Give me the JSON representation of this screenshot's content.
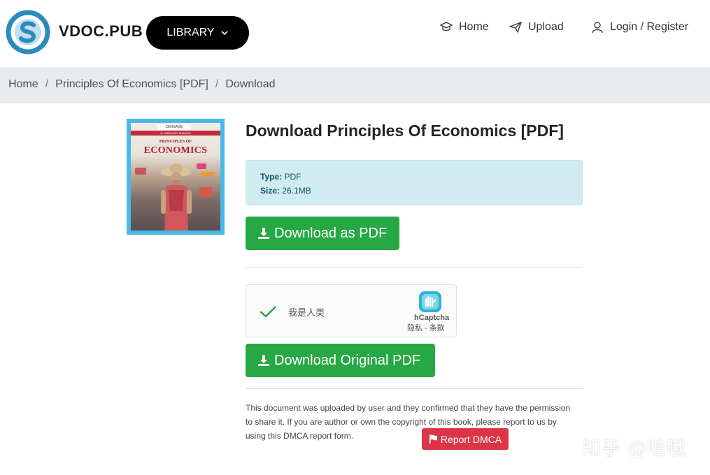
{
  "header": {
    "brand": "VDOC.PUB",
    "library_label": "LIBRARY",
    "nav": {
      "home": "Home",
      "upload": "Upload",
      "login": "Login / Register"
    }
  },
  "breadcrumb": {
    "items": [
      "Home",
      "Principles Of Economics [PDF]",
      "Download"
    ],
    "separator": "/"
  },
  "cover": {
    "publisher": "CENGAGE",
    "author": "N. GREGORY MANKIW",
    "title_line1": "PRINCIPLES OF",
    "title_line2": "ECONOMICS"
  },
  "main": {
    "title": "Download Principles Of Economics [PDF]",
    "info": {
      "type_label": "Type:",
      "type_value": "PDF",
      "size_label": "Size:",
      "size_value": "26.1MB"
    },
    "download_pdf_label": "Download as PDF",
    "download_original_label": "Download Original PDF",
    "captcha": {
      "label": "我是人类",
      "brand": "hCaptcha",
      "links": "隐私 - 条款"
    },
    "notice_text": "This document was uploaded by user and they confirmed that they have the permission to share it. If you are author or own the copyright of this book, please report to us by using this DMCA report form.",
    "dmca_label": "Report DMCA"
  },
  "watermark": "知乎 @哇哦",
  "colors": {
    "primary_green": "#28a745",
    "danger_red": "#dc3545",
    "info_bg": "#d1ecf1",
    "logo_blue": "#2a8bbd"
  },
  "icons": [
    "logo-icon",
    "chevron-down-icon",
    "graduation-cap-icon",
    "paper-plane-icon",
    "user-icon",
    "download-icon",
    "checkmark-icon",
    "hcaptcha-icon",
    "flag-icon"
  ]
}
